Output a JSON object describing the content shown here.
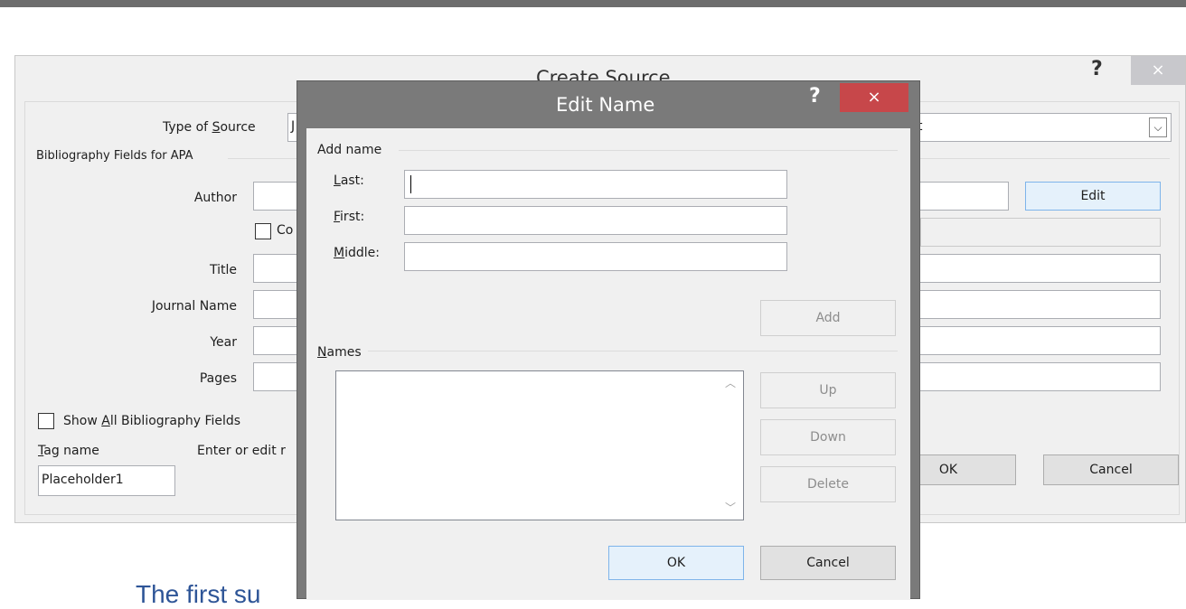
{
  "create_source": {
    "title": "Create Source",
    "help": "?",
    "close": "×",
    "type_label_pre": "Type of ",
    "type_label_key": "S",
    "type_label_post": "ource",
    "type_value_partial": "J",
    "type_value_tail": "t",
    "dropdown_arrow": "⌵",
    "group_label": "Bibliography Fields for APA",
    "author_label": "Author",
    "edit_button": "Edit",
    "corporate_partial": "Co",
    "title_label": "Title",
    "journal_label": "Journal Name",
    "year_label": "Year",
    "pages_label": "Pages",
    "show_all_pre": "Show ",
    "show_all_key": "A",
    "show_all_post": "ll Bibliography Fields",
    "tag_key": "T",
    "tag_post": "ag name",
    "tag_value": "Placeholder1",
    "enter_partial": "Enter or edit r",
    "ok": "OK",
    "cancel": "Cancel"
  },
  "edit_name": {
    "title": "Edit Name",
    "help": "?",
    "close": "×",
    "add_name_group": "Add name",
    "last_key": "L",
    "last_post": "ast:",
    "first_key": "F",
    "first_post": "irst:",
    "middle_key": "M",
    "middle_post": "iddle:",
    "last_value": "",
    "first_value": "",
    "middle_value": "",
    "add_button": "Add",
    "names_key": "N",
    "names_post": "ames",
    "up_button": "Up",
    "down_button": "Down",
    "delete_button": "Delete",
    "ok": "OK",
    "cancel": "Cancel",
    "scroll_up": "︿",
    "scroll_down": "﹀"
  },
  "document": {
    "heading_partial": "The first su"
  }
}
